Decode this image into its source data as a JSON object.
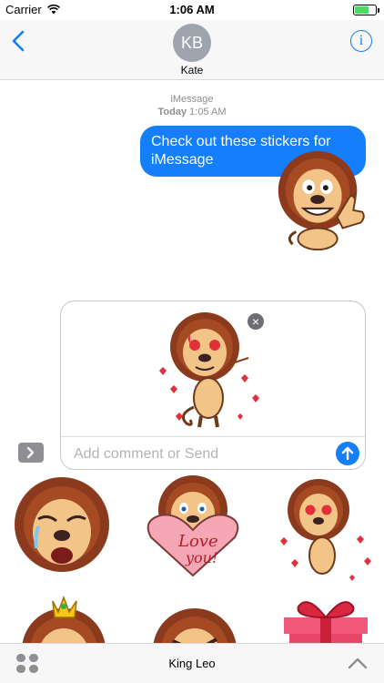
{
  "status_bar": {
    "carrier": "Carrier",
    "time": "1:06 AM",
    "battery_level": 0.7
  },
  "header": {
    "contact_initials": "KB",
    "contact_name": "Kate",
    "info_glyph": "i"
  },
  "conversation": {
    "service": "iMessage",
    "day": "Today",
    "time": "1:05 AM",
    "messages": [
      {
        "from": "me",
        "text": "Check out these stickers for iMessage"
      }
    ]
  },
  "compose": {
    "placeholder": "Add comment or Send",
    "remove_glyph": "×"
  },
  "drawer": {
    "app_name": "King Leo",
    "stickers": [
      "lion-crying",
      "lion-love-you-heart",
      "lion-heart-eyes",
      "lion-crown-sunglasses",
      "lion-angry",
      "gift-box"
    ],
    "sticker_text": {
      "love": "Love",
      "you": "you!"
    }
  },
  "colors": {
    "accent": "#147efb",
    "lion_mane": "#8b3a1e",
    "lion_face": "#f2c488",
    "heart": "#e0303a"
  },
  "icons": [
    "back-chevron-icon",
    "info-icon",
    "remove-icon",
    "send-arrow-icon",
    "expand-chevron-icon",
    "app-drawer-icon",
    "collapse-chevron-icon"
  ]
}
